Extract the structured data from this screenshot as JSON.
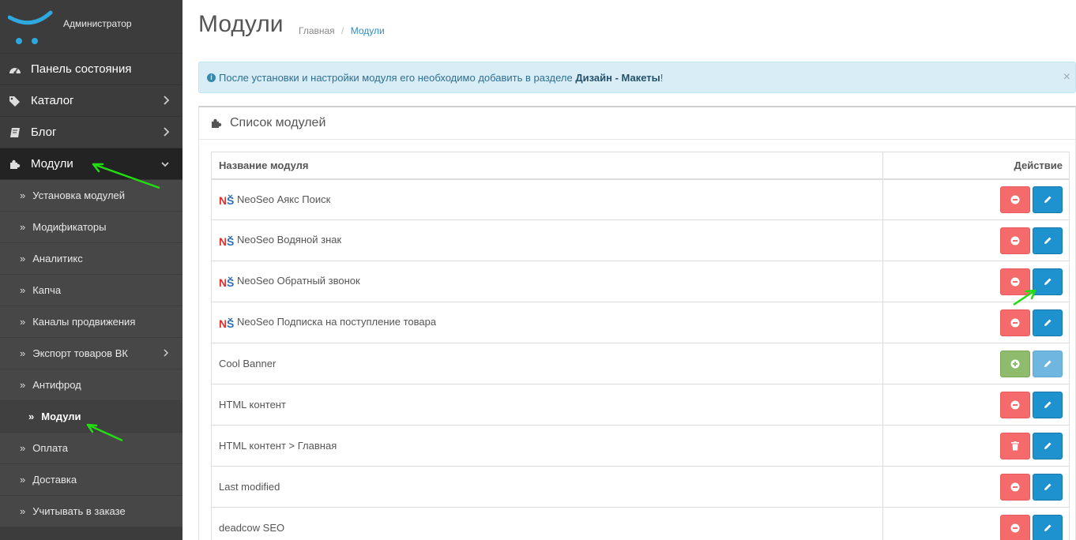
{
  "user": {
    "name": "Администратор"
  },
  "sidebar": {
    "top": [
      {
        "label": "Панель состояния",
        "icon": "dashboard-icon"
      },
      {
        "label": "Каталог",
        "icon": "tags-icon"
      },
      {
        "label": "Блог",
        "icon": "book-icon"
      },
      {
        "label": "Модули",
        "icon": "puzzle-icon"
      }
    ],
    "sub": [
      {
        "label": "Установка модулей"
      },
      {
        "label": "Модификаторы"
      },
      {
        "label": "Аналитикс"
      },
      {
        "label": "Капча"
      },
      {
        "label": "Каналы продвижения"
      },
      {
        "label": "Экспорт товаров ВК"
      },
      {
        "label": "Антифрод"
      },
      {
        "label": "Модули"
      },
      {
        "label": "Оплата"
      },
      {
        "label": "Доставка"
      },
      {
        "label": "Учитывать в заказе"
      }
    ]
  },
  "header": {
    "title": "Модули",
    "breadcrumb": {
      "home": "Главная",
      "sep": "/",
      "current": "Модули"
    }
  },
  "alert": {
    "text": "После установки и настройки модуля его необходимо добавить в разделе ",
    "link": "Дизайн - Макеты",
    "end": "!",
    "close": "×"
  },
  "panel": {
    "title": "Список модулей",
    "columns": {
      "name": "Название модуля",
      "action": "Действие"
    },
    "rows": [
      {
        "name": "NeoSeo Аякс Поиск",
        "neoseo": true,
        "state": "installed"
      },
      {
        "name": "NeoSeo Водяной знак",
        "neoseo": true,
        "state": "installed"
      },
      {
        "name": "NeoSeo Обратный звонок",
        "neoseo": true,
        "state": "installed"
      },
      {
        "name": "NeoSeo Подписка на поступление товара",
        "neoseo": true,
        "state": "installed"
      },
      {
        "name": "Cool Banner",
        "neoseo": false,
        "state": "not-installed"
      },
      {
        "name": "HTML контент",
        "neoseo": false,
        "state": "installed"
      },
      {
        "name": "HTML контент > Главная",
        "neoseo": false,
        "state": "instance"
      },
      {
        "name": "Last modified",
        "neoseo": false,
        "state": "installed"
      },
      {
        "name": "deadcow SEO",
        "neoseo": false,
        "state": "installed"
      }
    ]
  },
  "colors": {
    "sidebar_bg": "#3c3c3c",
    "alert_bg": "#d9edf7",
    "btn_red": "#f56b6b",
    "btn_blue": "#1e91cf",
    "btn_green": "#8fbb6c",
    "annotation_arrow": "#22dd11"
  }
}
